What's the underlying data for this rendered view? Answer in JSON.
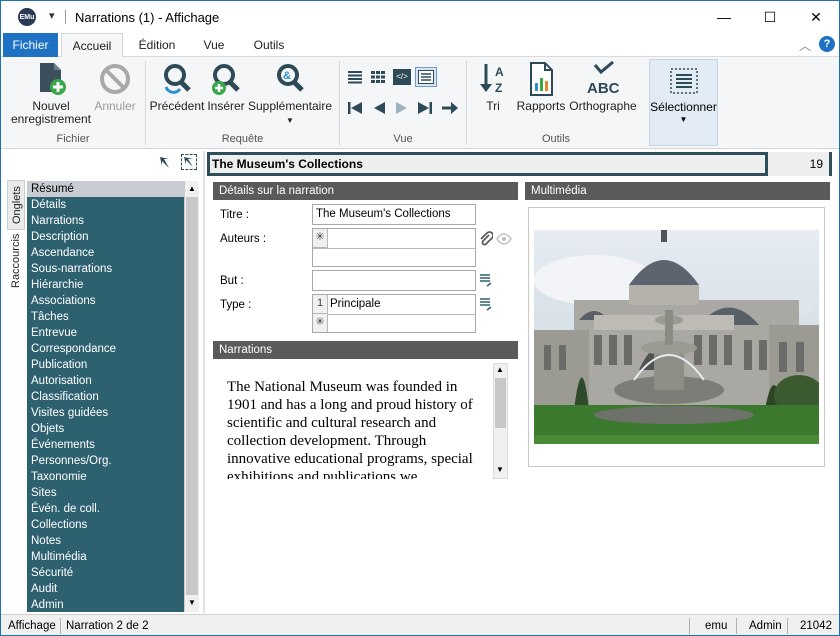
{
  "window": {
    "title": "Narrations (1) - Affichage",
    "app_icon_text": "EMu",
    "minimize": "—",
    "maximize": "☐",
    "close": "✕"
  },
  "tabs": {
    "fichier": "Fichier",
    "accueil": "Accueil",
    "edition": "Édition",
    "vue": "Vue",
    "outils": "Outils"
  },
  "ribbon": {
    "fichier_group": "Fichier",
    "requete_group": "Requête",
    "vue_group": "Vue",
    "outils_group": "Outils",
    "nouvel_line1": "Nouvel",
    "nouvel_line2": "enregistrement",
    "annuler": "Annuler",
    "precedent": "Précédent",
    "inserer": "Insérer",
    "supplementaire": "Supplémentaire",
    "tri": "Tri",
    "rapports": "Rapports",
    "orthographe": "Orthographe",
    "selectionner": "Sélectionner",
    "abc": "ABC"
  },
  "sidetabs": {
    "onglets": "Onglets",
    "raccourcis": "Raccourcis"
  },
  "nav": {
    "items": [
      "Résumé",
      "Détails",
      "Narrations",
      "Description",
      "Ascendance",
      "Sous-narrations",
      "Hiérarchie",
      "Associations",
      "Tâches",
      "Entrevue",
      "Correspondance",
      "Publication",
      "Autorisation",
      "Classification",
      "Visites guidées",
      "Objets",
      "Événements",
      "Personnes/Org.",
      "Taxonomie",
      "Sites",
      "Évén. de coll.",
      "Collections",
      "Notes",
      "Multimédia",
      "Sécurité",
      "Audit",
      "Admin"
    ],
    "selected": 0
  },
  "header": {
    "title": "The Museum's Collections",
    "count": "19"
  },
  "details": {
    "heading": "Détails sur la narration",
    "titre_label": "Titre :",
    "titre_value": "The Museum's Collections",
    "auteurs_label": "Auteurs :",
    "but_label": "But :",
    "but_value": "",
    "type_label": "Type :",
    "type_row_num": "1",
    "type_value": "Principale",
    "new_row_marker": "✳"
  },
  "narrations": {
    "heading": "Narrations",
    "text": "The National Museum was founded in 1901 and has a long and proud history of scientific and cultural research and collection development. Through innovative educational programs, special exhibitions and publications we"
  },
  "multimedia": {
    "heading": "Multimédia"
  },
  "status": {
    "mode": "Affichage",
    "record": "Narration 2 de 2",
    "user": "emu",
    "group": "Admin",
    "port": "21042"
  },
  "colors": {
    "accent": "#1f72c3",
    "nav_bg": "#2e6170",
    "section_header": "#5a5a5a",
    "header_border": "#2e4f5a"
  }
}
